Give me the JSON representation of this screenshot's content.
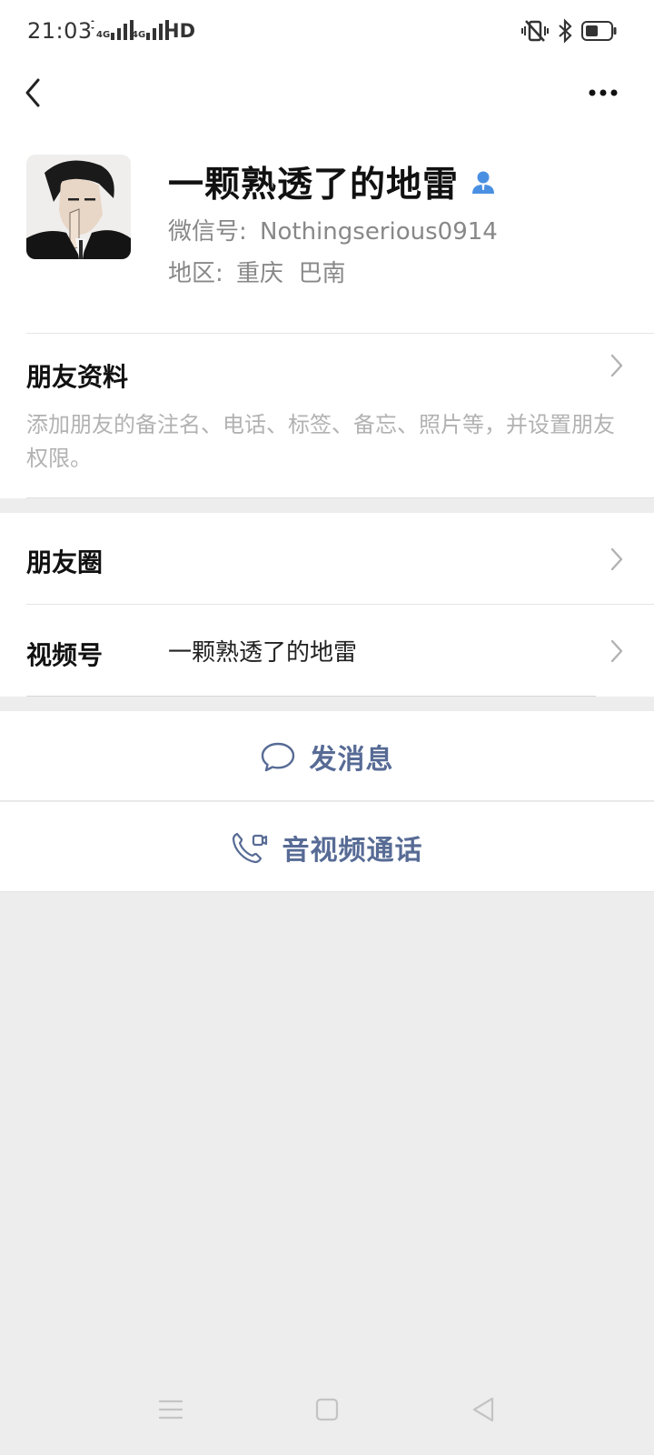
{
  "status_bar": {
    "time": "21:03",
    "net1": "4G",
    "net2": "4G",
    "hd": "HD"
  },
  "profile": {
    "nickname": "一颗熟透了的地雷",
    "wxid_label": "微信号:",
    "wxid": "Nothingserious0914",
    "region_label": "地区:",
    "region": "重庆  巴南"
  },
  "friend_info": {
    "title": "朋友资料",
    "description": "添加朋友的备注名、电话、标签、备忘、照片等，并设置朋友权限。"
  },
  "moments": {
    "label": "朋友圈"
  },
  "channels": {
    "label": "视频号",
    "value": "一颗熟透了的地雷"
  },
  "actions": {
    "message_label": "发消息",
    "call_label": "音视频通话"
  },
  "colors": {
    "link": "#576b95",
    "contact_icon": "#4a90e2",
    "background": "#ededed"
  },
  "icons": {
    "back": "back-arrow-icon",
    "more": "more-dots-icon",
    "contact": "contact-person-icon",
    "message": "chat-bubble-icon",
    "call": "video-call-icon",
    "chevron": "chevron-right-icon"
  }
}
